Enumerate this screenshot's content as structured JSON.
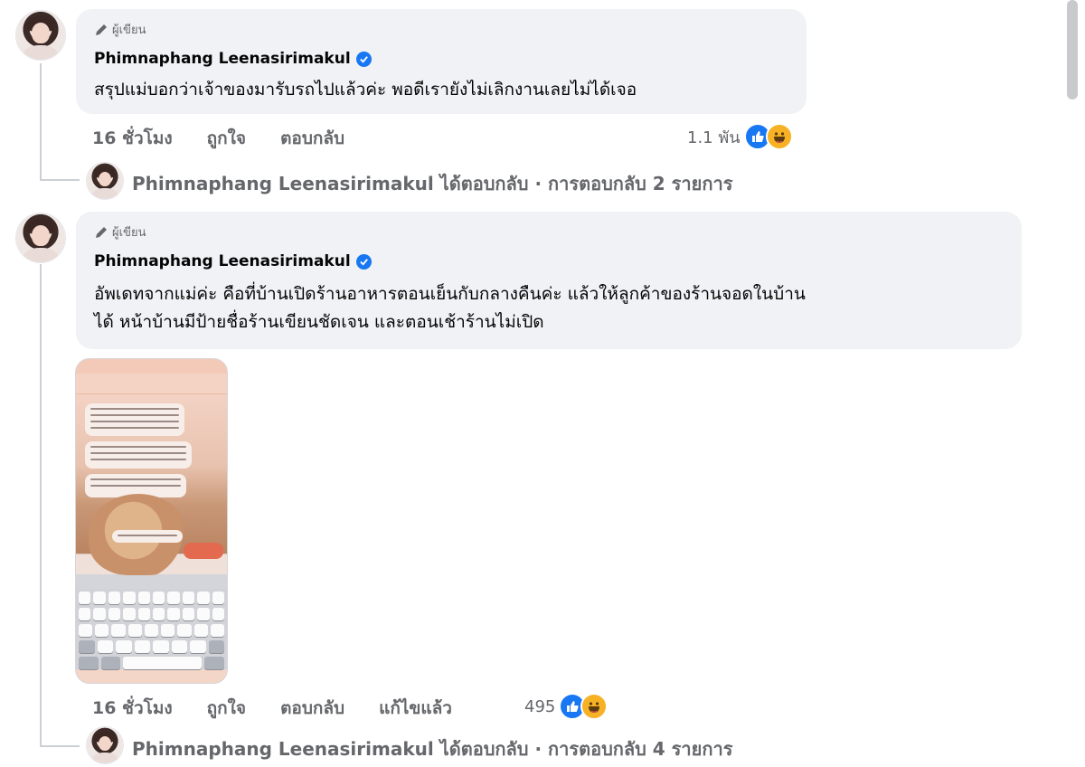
{
  "comments": [
    {
      "author_badge": "ผู้เขียน",
      "name": "Phimnaphang Leenasirimakul",
      "text_lines": [
        "สรุปแม่บอกว่าเจ้าของมารับรถไปแล้วค่ะ พอดีเรายังไม่เลิกงานเลยไม่ได้เจอ"
      ],
      "time": "16 ชั่วโมง",
      "like_label": "ถูกใจ",
      "reply_label": "ตอบกลับ",
      "reaction_count": "1.1 พัน",
      "reply_summary": "Phimnaphang Leenasirimakul ได้ตอบกลับ · การตอบกลับ 2 รายการ"
    },
    {
      "author_badge": "ผู้เขียน",
      "name": "Phimnaphang Leenasirimakul",
      "text_lines": [
        "อัพเดทจากแม่ค่ะ คือที่บ้านเปิดร้านอาหารตอนเย็นกับกลางคืนค่ะ แล้วให้ลูกค้าของร้านจอดในบ้าน",
        "ได้ หน้าบ้านมีป้ายชื่อร้านเขียนชัดเจน และตอนเช้าร้านไม่เปิด"
      ],
      "time": "16 ชั่วโมง",
      "like_label": "ถูกใจ",
      "reply_label": "ตอบกลับ",
      "edited_label": "แก้ไขแล้ว",
      "reaction_count": "495",
      "reply_summary": "Phimnaphang Leenasirimakul ได้ตอบกลับ · การตอบกลับ 4 รายการ"
    }
  ],
  "icons": {
    "author_badge_icon": "pencil-icon",
    "verified_icon": "verified-check-icon",
    "reactions": [
      "like-icon",
      "haha-icon"
    ]
  },
  "colors": {
    "bubble": "#f0f2f5",
    "secondary_text": "#65676b",
    "verified": "#1877f2"
  }
}
